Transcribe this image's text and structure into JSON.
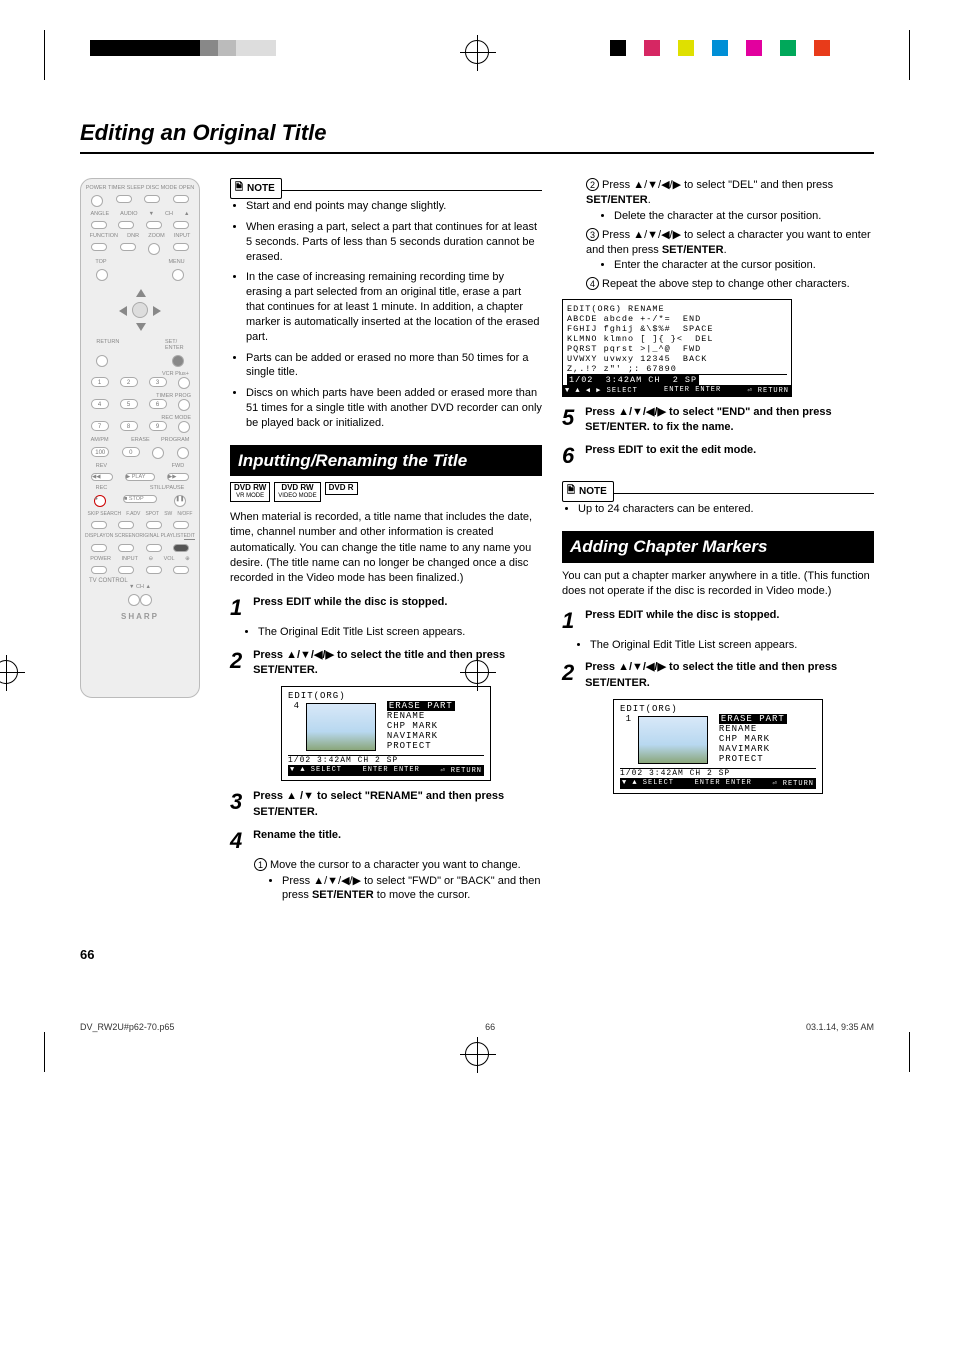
{
  "page": {
    "title": "Editing an Original Title",
    "number": "66"
  },
  "footer": {
    "file": "DV_RW2U#p62-70.p65",
    "page": "66",
    "timestamp": "03.1.14, 9:35 AM"
  },
  "remote": {
    "labels": {
      "power": "POWER",
      "timer": "TIMER SLEEP",
      "disc": "DISC MODE",
      "open": "OPEN",
      "angle": "ANGLE",
      "audio": "AUDIO",
      "ch": "CH",
      "function": "FUNCTION",
      "dnr": "DNR",
      "zoom": "ZOOM",
      "input": "INPUT",
      "top": "TOP",
      "menu": "MENU",
      "return": "RETURN",
      "setenter": "SET/\nENTER",
      "vcrplus": "VCR Plus+",
      "timerprog": "TIMER PROG",
      "recmode": "REC MODE",
      "am_pm": "AM/PM",
      "erase": "ERASE",
      "program": "PROGRAM",
      "rev": "REV",
      "play": "PLAY",
      "fwd": "FWD",
      "rec": "REC",
      "stop": "STOP",
      "pause": "STILL/PAUSE",
      "skip": "SKIP SEARCH",
      "fadv": "F.ADV",
      "spot": "SPOT",
      "sw": "SW",
      "on_off": "N/OFF",
      "display": "DISPLAY",
      "screen": "ON SCREEN",
      "playlist": "ORIGINAL PLAYLIST",
      "edit": "EDIT",
      "power2": "POWER",
      "input2": "INPUT",
      "vol": "VOL",
      "tvcontrol": "TV CONTROL",
      "brand": "SHARP"
    }
  },
  "note1": {
    "label": "NOTE",
    "items": [
      "Start and end points may change slightly.",
      "When erasing a part, select a part that continues for at least 5 seconds. Parts of less than 5 seconds duration cannot be erased.",
      "In the case of increasing remaining recording time by erasing a part selected from an original title, erase a part that continues for at least 1 minute. In addition, a chapter marker is automatically inserted at the location of the erased part.",
      "Parts can be added or erased no more than 50 times for a single title.",
      "Discs on which parts have been added or erased more than 51 times for a single title with another DVD recorder can only be played back or initialized."
    ]
  },
  "section1": {
    "header": "Inputting/Renaming the Title",
    "tags": [
      {
        "top": "DVD RW",
        "sub": "VR MODE"
      },
      {
        "top": "DVD RW",
        "sub": "VIDEO MODE"
      },
      {
        "top": "DVD R",
        "sub": ""
      }
    ],
    "intro": "When material is recorded, a title name that includes the date, time, channel number and other information is created automatically. You can change the title name to any name you desire. (The title name can no longer be changed once a disc recorded in the Video mode has been finalized.)",
    "steps": {
      "1": {
        "a": "Press ",
        "b": "EDIT",
        "c": " while the disc is stopped.",
        "sub": "The Original Edit Title List screen appears."
      },
      "2": {
        "a": "Press ",
        "arrows": "▲/▼/◀/▶",
        "c": " to select the title and then press ",
        "d": "SET/ENTER."
      },
      "3": {
        "a": "Press ",
        "arrows": "▲ /▼",
        "c": " to select \"RENAME\" and then press ",
        "d": "SET/ENTER."
      },
      "4": {
        "title": "Rename the title.",
        "c1a": "Move the cursor to a character you want to change.",
        "c1b_pre": "Press ",
        "c1b_arr": "▲/▼/◀/▶",
        "c1b_mid": " to select \"FWD\" or \"BACK\" and then press ",
        "c1b_key": "SET/ENTER",
        "c1b_post": " to move the cursor.",
        "c2a_pre": "Press ",
        "c2a_arr": "▲/▼/◀/▶",
        "c2a_mid": " to select \"DEL\" and then press ",
        "c2a_key": "SET/ENTER",
        "c2a_post": ".",
        "c2b": "Delete the character at the cursor position.",
        "c3a_pre": "Press ",
        "c3a_arr": "▲/▼/◀/▶",
        "c3a_mid": " to select a character you want to enter and then press ",
        "c3a_key": "SET/ENTER",
        "c3a_post": ".",
        "c3b": "Enter the character at the cursor position.",
        "c4": "Repeat the above step to change other characters."
      },
      "5": {
        "a": "Press ",
        "arrows": "▲/▼/◀/▶",
        "c": " to select \"END\" and then press ",
        "d": "SET/ENTER.",
        "e": " to fix the name."
      },
      "6": {
        "a": "Press ",
        "b": "EDIT",
        "c": " to exit the edit mode."
      }
    }
  },
  "osd1": {
    "title": "EDIT(ORG)",
    "num": "4",
    "menu": [
      "ERASE PART",
      "RENAME",
      "CHP MARK",
      "NAVIMARK",
      "PROTECT"
    ],
    "status": "1/02  3:42AM  CH   2  SP",
    "ctl_left": "▼ ▲ SELECT",
    "ctl_mid": "ENTER ENTER",
    "ctl_right": "⏎ RETURN"
  },
  "osd_rename": {
    "title": "EDIT(ORG) RENAME",
    "rows": [
      "ABCDE abcde +-/*=  END",
      "FGHIJ fghij &\\$%#  SPACE",
      "KLMNO klmno [ ]{ }<  DEL",
      "PQRST pqrst >|_^@  FWD",
      "UVWXY uvwxy 12345  BACK",
      "Z,.!? z\"' ;: 67890"
    ],
    "status_sel": "1/02  3:42AM CH  2 SP",
    "ctl_left": "▼ ▲ ◀ ▶ SELECT",
    "ctl_mid": "ENTER ENTER",
    "ctl_right": "⏎ RETURN"
  },
  "note2": {
    "label": "NOTE",
    "item": "Up to 24 characters can be entered."
  },
  "section2": {
    "header": "Adding Chapter Markers",
    "intro": "You can put a chapter marker anywhere in a title. (This function does not operate if the disc is recorded in Video mode.)",
    "steps": {
      "1": {
        "a": "Press ",
        "b": "EDIT",
        "c": " while the disc is stopped.",
        "sub": "The Original Edit Title List screen appears."
      },
      "2": {
        "a": "Press ",
        "arrows": "▲/▼/◀/▶",
        "c": " to select the title and then press ",
        "d": "SET/ENTER."
      }
    }
  },
  "osd2": {
    "title": "EDIT(ORG)",
    "num": "1",
    "menu": [
      "ERASE PART",
      "RENAME",
      "CHP MARK",
      "NAVIMARK",
      "PROTECT"
    ],
    "status": "1/02  3:42AM  CH   2  SP",
    "ctl_left": "▼ ▲ SELECT",
    "ctl_mid": "ENTER ENTER",
    "ctl_right": "⏎ RETURN"
  }
}
